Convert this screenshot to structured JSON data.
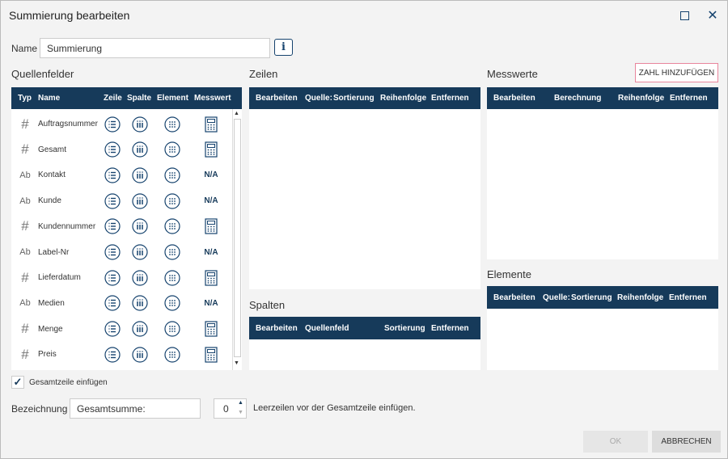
{
  "window": {
    "title": "Summierung bearbeiten"
  },
  "name": {
    "label": "Name",
    "value": "Summierung"
  },
  "source": {
    "title": "Quellenfelder",
    "columns": [
      "Typ",
      "Name",
      "Zeile",
      "Spalte",
      "Element",
      "Messwert"
    ],
    "rows": [
      {
        "type": "#",
        "name": "Auftragsnummer",
        "measure": "calc"
      },
      {
        "type": "#",
        "name": "Gesamt",
        "measure": "calc"
      },
      {
        "type": "Ab",
        "name": "Kontakt",
        "measure": "N/A"
      },
      {
        "type": "Ab",
        "name": "Kunde",
        "measure": "N/A"
      },
      {
        "type": "#",
        "name": "Kundennummer",
        "measure": "calc"
      },
      {
        "type": "Ab",
        "name": "Label-Nr",
        "measure": "N/A"
      },
      {
        "type": "#",
        "name": "Lieferdatum",
        "measure": "calc"
      },
      {
        "type": "Ab",
        "name": "Medien",
        "measure": "N/A"
      },
      {
        "type": "#",
        "name": "Menge",
        "measure": "calc"
      },
      {
        "type": "#",
        "name": "Preis",
        "measure": "calc"
      }
    ]
  },
  "zeilen": {
    "title": "Zeilen",
    "columns": [
      "Bearbeiten",
      "Quelle:",
      "Sortierung",
      "Reihenfolge",
      "Entfernen"
    ]
  },
  "spalten": {
    "title": "Spalten",
    "columns": [
      "Bearbeiten",
      "Quellenfeld",
      "Sortierung",
      "Entfernen"
    ]
  },
  "messwerte": {
    "title": "Messwerte",
    "add_button": "ZAHL HINZUFÜGEN",
    "columns": [
      "Bearbeiten",
      "Berechnung",
      "Reihenfolge",
      "Entfernen"
    ]
  },
  "elemente": {
    "title": "Elemente",
    "columns": [
      "Bearbeiten",
      "Quelle:",
      "Sortierung",
      "Reihenfolge",
      "Entfernen"
    ]
  },
  "total": {
    "checkbox_label": "Gesamtzeile einfügen",
    "checked": true,
    "label": "Bezeichnung",
    "value": "Gesamtsumme:",
    "blank_lines": "0",
    "blank_lines_label": "Leerzeilen vor der Gesamtzeile einfügen."
  },
  "buttons": {
    "ok": "OK",
    "cancel": "ABBRECHEN"
  },
  "colors": {
    "header": "#163a5a",
    "accent": "#e8859c"
  }
}
